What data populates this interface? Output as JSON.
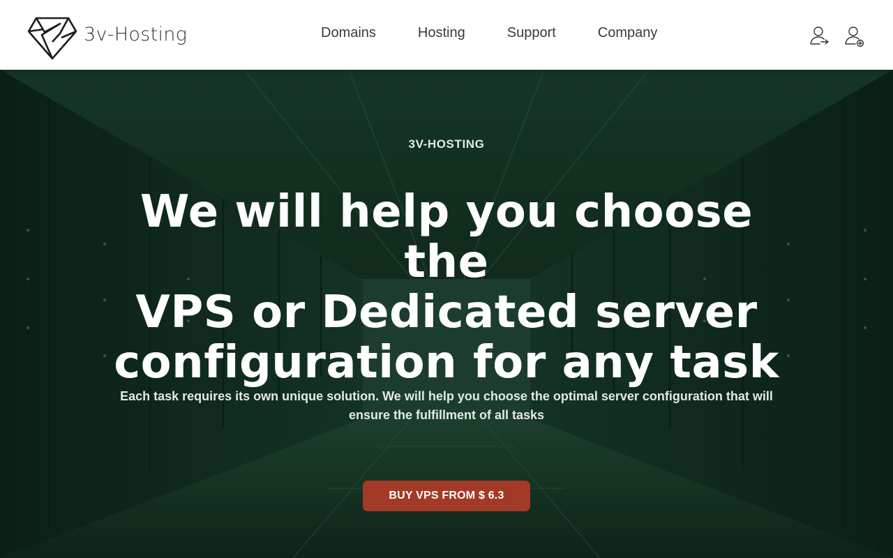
{
  "brand": {
    "name": "3v-Hosting",
    "icon": "diamond-logo-icon"
  },
  "nav": {
    "items": [
      {
        "label": "Domains"
      },
      {
        "label": "Hosting"
      },
      {
        "label": "Support"
      },
      {
        "label": "Company"
      }
    ]
  },
  "account": {
    "login_icon": "user-login-icon",
    "signup_icon": "user-add-icon"
  },
  "hero": {
    "eyebrow": "3V-HOSTING",
    "title_lines": [
      "We will help you choose the",
      "VPS or Dedicated server",
      "configuration for any task"
    ],
    "subtitle": "Each task requires its own unique solution. We will help you choose the optimal server configuration that will ensure the fulfillment of all tasks",
    "cta_label": "BUY VPS FROM $ 6.3"
  },
  "colors": {
    "accent": "#a23a27",
    "hero_overlay": "#0f2a1e",
    "header_bg": "#ffffff"
  }
}
